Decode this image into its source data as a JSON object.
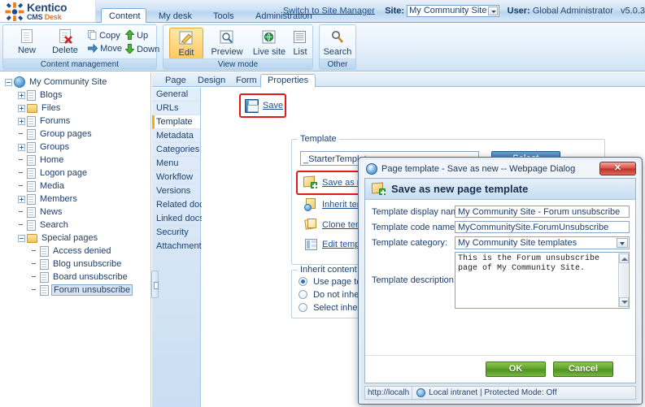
{
  "app": {
    "logo_name": "Kentico",
    "logo_sub_1": "CMS ",
    "logo_sub_2": "Desk"
  },
  "header": {
    "main_tabs": [
      {
        "label": "Content",
        "active": true
      },
      {
        "label": "My desk",
        "active": false
      },
      {
        "label": "Tools",
        "active": false
      },
      {
        "label": "Administration",
        "active": false
      }
    ],
    "switch_link": "Switch to Site Manager",
    "site_label": "Site:",
    "site_value": "My Community Site",
    "user_label": "User:",
    "user_value": "Global Administrator",
    "version": "v5.0.3"
  },
  "ribbon": {
    "groups": [
      {
        "caption": "Content management",
        "large_buttons": [
          {
            "label": "New",
            "icon": "new-page-icon"
          },
          {
            "label": "Delete",
            "icon": "delete-page-icon"
          }
        ],
        "small_buttons": [
          {
            "label": "Copy",
            "icon": "copy-icon"
          },
          {
            "label": "Move",
            "icon": "move-icon"
          },
          {
            "label": "Up",
            "icon": "arrow-up-icon"
          },
          {
            "label": "Down",
            "icon": "arrow-down-icon"
          }
        ]
      },
      {
        "caption": "View mode",
        "large_buttons": [
          {
            "label": "Edit",
            "icon": "edit-icon",
            "selected": true
          },
          {
            "label": "Preview",
            "icon": "preview-icon"
          },
          {
            "label": "Live site",
            "icon": "live-site-icon"
          },
          {
            "label": "List",
            "icon": "list-icon"
          }
        ],
        "small_buttons": []
      },
      {
        "caption": "Other",
        "large_buttons": [
          {
            "label": "Search",
            "icon": "search-icon"
          }
        ],
        "small_buttons": []
      }
    ]
  },
  "tree": {
    "nodes": [
      {
        "label": "My Community Site",
        "indent": 0,
        "expander": "minus",
        "icon": "globe-icon",
        "selected": false
      },
      {
        "label": "Blogs",
        "indent": 1,
        "expander": "plus",
        "icon": "page-icon",
        "selected": false
      },
      {
        "label": "Files",
        "indent": 1,
        "expander": "plus",
        "icon": "folder-icon",
        "selected": false
      },
      {
        "label": "Forums",
        "indent": 1,
        "expander": "plus",
        "icon": "page-icon",
        "selected": false
      },
      {
        "label": "Group pages",
        "indent": 1,
        "expander": "none",
        "icon": "page-icon",
        "selected": false
      },
      {
        "label": "Groups",
        "indent": 1,
        "expander": "plus",
        "icon": "page-icon",
        "selected": false
      },
      {
        "label": "Home",
        "indent": 1,
        "expander": "none",
        "icon": "page-icon",
        "selected": false
      },
      {
        "label": "Logon page",
        "indent": 1,
        "expander": "none",
        "icon": "page-icon",
        "selected": false
      },
      {
        "label": "Media",
        "indent": 1,
        "expander": "none",
        "icon": "page-icon",
        "selected": false
      },
      {
        "label": "Members",
        "indent": 1,
        "expander": "plus",
        "icon": "page-icon",
        "selected": false
      },
      {
        "label": "News",
        "indent": 1,
        "expander": "none",
        "icon": "page-icon",
        "selected": false
      },
      {
        "label": "Search",
        "indent": 1,
        "expander": "none",
        "icon": "page-icon",
        "selected": false
      },
      {
        "label": "Special pages",
        "indent": 1,
        "expander": "minus",
        "icon": "folder-icon",
        "selected": false
      },
      {
        "label": "Access denied",
        "indent": 2,
        "expander": "none",
        "icon": "page-icon",
        "selected": false
      },
      {
        "label": "Blog unsubscribe",
        "indent": 2,
        "expander": "none",
        "icon": "page-icon",
        "selected": false
      },
      {
        "label": "Board unsubscribe",
        "indent": 2,
        "expander": "none",
        "icon": "page-icon",
        "selected": false
      },
      {
        "label": "Forum unsubscribe",
        "indent": 2,
        "expander": "none",
        "icon": "page-icon",
        "selected": true
      }
    ]
  },
  "content_tabs": [
    {
      "label": "Page",
      "active": false
    },
    {
      "label": "Design",
      "active": false
    },
    {
      "label": "Form",
      "active": false
    },
    {
      "label": "Properties",
      "active": true
    }
  ],
  "properties_menu": [
    {
      "label": "General",
      "active": false
    },
    {
      "label": "URLs",
      "active": false
    },
    {
      "label": "Template",
      "active": true
    },
    {
      "label": "Metadata",
      "active": false
    },
    {
      "label": "Categories",
      "active": false
    },
    {
      "label": "Menu",
      "active": false
    },
    {
      "label": "Workflow",
      "active": false
    },
    {
      "label": "Versions",
      "active": false
    },
    {
      "label": "Related docs",
      "active": false
    },
    {
      "label": "Linked docs",
      "active": false
    },
    {
      "label": "Security",
      "active": false
    },
    {
      "label": "Attachments",
      "active": false
    }
  ],
  "main": {
    "save_label": "Save",
    "template_legend": "Template",
    "template_value": "_StarterTemplate",
    "select_label": "Select",
    "links": [
      {
        "label": "Save as new template",
        "icon": "save-as-new-template-icon"
      },
      {
        "label": "Inherit template",
        "icon": "inherit-template-icon"
      },
      {
        "label": "Clone template as ad-hoc",
        "icon": "clone-template-icon"
      },
      {
        "label": "Edit template properties",
        "icon": "edit-template-properties-icon"
      }
    ],
    "inherit_legend": "Inherit content",
    "inherit_options": [
      {
        "label": "Use page template settings",
        "selected": true
      },
      {
        "label": "Do not inherit any content",
        "selected": false
      },
      {
        "label": "Select inherited levels",
        "selected": false
      }
    ]
  },
  "dialog": {
    "title": "Page template - Save as new -- Webpage Dialog",
    "close_glyph": "✕",
    "heading": "Save as new page template",
    "fields": [
      {
        "label": "Template display name:",
        "value": "My Community Site - Forum unsubscribe"
      },
      {
        "label": "Template code name:",
        "value": "MyCommunitySite.ForumUnsubscribe"
      },
      {
        "label": "Template category:",
        "value": "My Community Site templates"
      }
    ],
    "description_label": "Template description:",
    "description_value": "This is the Forum unsubscribe page of My Community Site.",
    "ok_label": "OK",
    "cancel_label": "Cancel",
    "status_url": "http://localh",
    "status_zone": "Local intranet | Protected Mode: Off"
  },
  "colors": {
    "accent_orange": "#e8741e",
    "highlight_red": "#e01b1b",
    "selected_yellow": "#fdc95f",
    "button_blue": "#3c7bbb",
    "button_green": "#5da32a"
  }
}
